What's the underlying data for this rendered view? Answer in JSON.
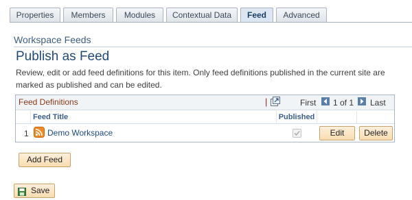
{
  "tabs": [
    {
      "label": "Properties",
      "active": false
    },
    {
      "label": "Members",
      "active": false
    },
    {
      "label": "Modules",
      "active": false
    },
    {
      "label": "Contextual Data",
      "active": false
    },
    {
      "label": "Feed",
      "active": true
    },
    {
      "label": "Advanced",
      "active": false
    }
  ],
  "section_title": "Workspace Feeds",
  "page_title": "Publish as Feed",
  "description": "Review, edit or add feed definitions for this item. Only feed definitions published in the current site are marked as published and can be edited.",
  "grid": {
    "title": "Feed Definitions",
    "separator": "|",
    "nav": {
      "first": "First",
      "count": "1 of 1",
      "last": "Last"
    },
    "columns": {
      "title": "Feed Title",
      "published": "Published"
    },
    "rows": [
      {
        "index": "1",
        "title": "Demo Workspace",
        "published": true,
        "edit_label": "Edit",
        "delete_label": "Delete"
      }
    ]
  },
  "add_feed_label": "Add Feed",
  "save_label": "Save",
  "icons": {
    "zoom": "zoom-icon",
    "prev": "previous-arrow-icon",
    "next": "next-arrow-icon",
    "rss": "rss-icon",
    "save": "save-disk-icon"
  },
  "colors": {
    "button_bg": "#f8dcb0",
    "button_border": "#c8a26c",
    "link": "#1d4a88",
    "title": "#214a76"
  }
}
